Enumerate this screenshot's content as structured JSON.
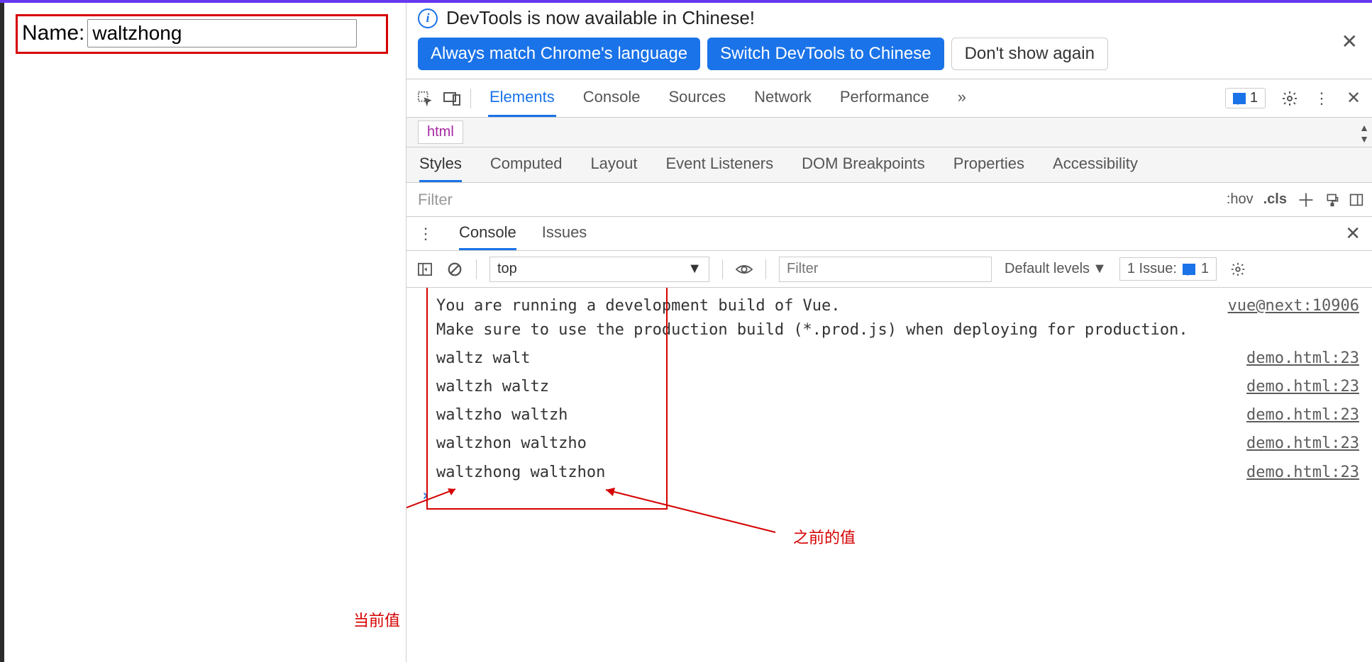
{
  "page": {
    "name_label": "Name:",
    "name_value": "waltzhong"
  },
  "banner": {
    "message": "DevTools is now available in Chinese!",
    "btn_match": "Always match Chrome's language",
    "btn_switch": "Switch DevTools to Chinese",
    "btn_dismiss": "Don't show again"
  },
  "main_tabs": [
    "Elements",
    "Console",
    "Sources",
    "Network",
    "Performance"
  ],
  "main_more": "»",
  "issues_count": "1",
  "breadcrumb": "html",
  "styles_tabs": [
    "Styles",
    "Computed",
    "Layout",
    "Event Listeners",
    "DOM Breakpoints",
    "Properties",
    "Accessibility"
  ],
  "styles_filter_placeholder": "Filter",
  "styles_tokens": {
    "hov": ":hov",
    "cls": ".cls"
  },
  "drawer_tabs": [
    "Console",
    "Issues"
  ],
  "console_toolbar": {
    "context": "top",
    "filter_placeholder": "Filter",
    "levels": "Default levels",
    "issue_label": "1 Issue:",
    "issue_count": "1"
  },
  "console_logs": [
    {
      "text": "You are running a development build of Vue.\nMake sure to use the production build (*.prod.js) when deploying for production.",
      "src": "vue@next:10906"
    },
    {
      "text": "waltz walt",
      "src": "demo.html:23"
    },
    {
      "text": "waltzh waltz",
      "src": "demo.html:23"
    },
    {
      "text": "waltzho waltzh",
      "src": "demo.html:23"
    },
    {
      "text": "waltzhon waltzho",
      "src": "demo.html:23"
    },
    {
      "text": "waltzhong waltzhon",
      "src": "demo.html:23"
    }
  ],
  "annotations": {
    "current": "当前值",
    "previous": "之前的值"
  }
}
